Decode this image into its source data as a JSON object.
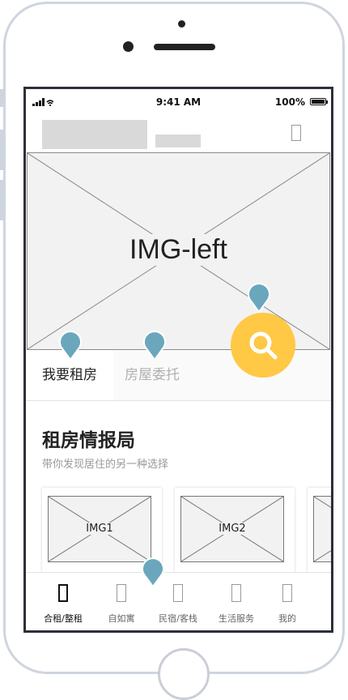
{
  "status_bar": {
    "time": "9:41 AM",
    "battery": "100%"
  },
  "hero": {
    "caption": "IMG-left"
  },
  "tabs": [
    {
      "label": "我要租房"
    },
    {
      "label": "房屋委托"
    }
  ],
  "section": {
    "title": "租房情报局",
    "subtitle": "带你发现居住的另一种选择"
  },
  "cards": [
    {
      "label": "IMG1"
    },
    {
      "label": "IMG2"
    }
  ],
  "tabbar": [
    {
      "label": "合租/整租"
    },
    {
      "label": "自如寓"
    },
    {
      "label": "民宿/客栈"
    },
    {
      "label": "生活服务"
    },
    {
      "label": "我的"
    }
  ],
  "colors": {
    "accent": "#ffc845",
    "pin": "#6aa7bd",
    "frame": "#2b2f3a"
  }
}
